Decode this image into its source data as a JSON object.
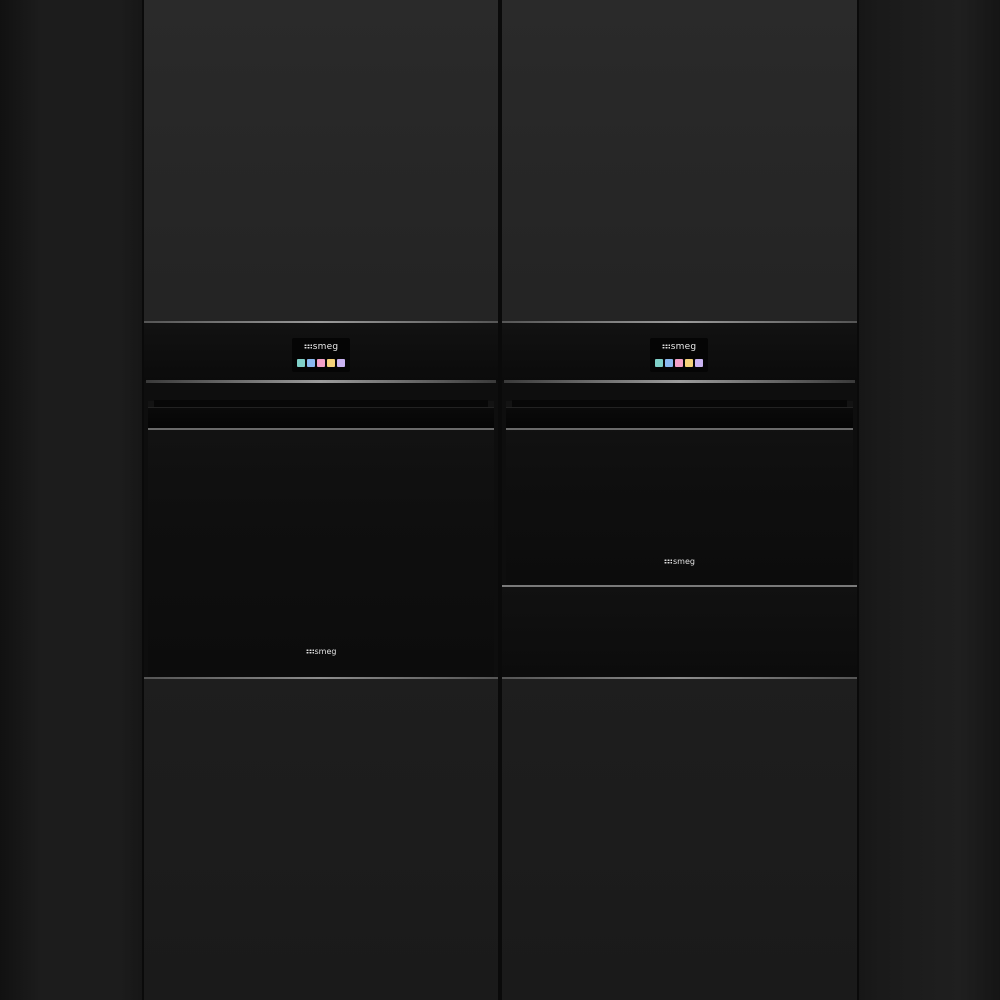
{
  "brand": "smeg",
  "colors": {
    "cabinet": "#222222",
    "appliance_glass": "#0e0e0e",
    "trim": "#9a9a9a"
  },
  "left_appliance": {
    "display_logo": "smeg",
    "door_logo": "smeg",
    "tile_colors": [
      "#7fd0c8",
      "#8ab8f0",
      "#f3a0c8",
      "#f5d27a",
      "#c9b3f2"
    ]
  },
  "right_appliance": {
    "display_logo": "smeg",
    "door_logo": "smeg",
    "tile_colors": [
      "#7fd0c8",
      "#8ab8f0",
      "#f3a0c8",
      "#f5d27a",
      "#c9b3f2"
    ]
  }
}
